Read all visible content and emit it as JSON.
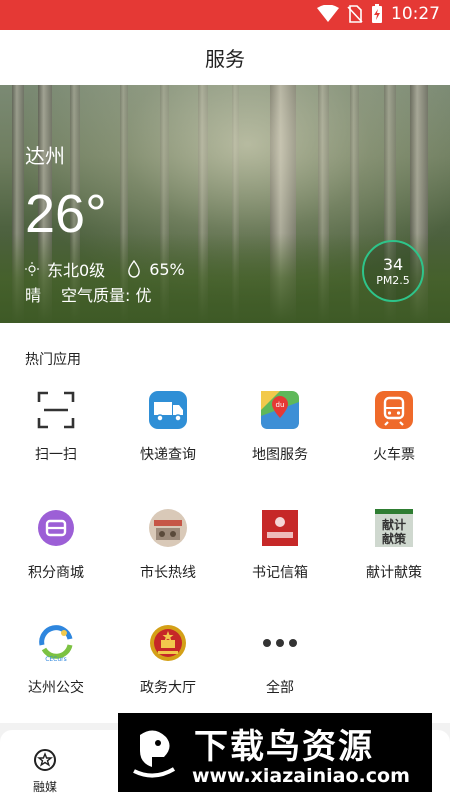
{
  "status_bar": {
    "time": "10:27",
    "icons": [
      "wifi-icon",
      "no-sim-icon",
      "battery-charging-icon"
    ]
  },
  "header": {
    "title": "服务"
  },
  "weather": {
    "city": "达州",
    "temperature": "26°",
    "wind": "东北0级",
    "humidity": "65%",
    "condition": "晴",
    "air_quality": "空气质量: 优",
    "pm_value": "34",
    "pm_label": "PM2.5"
  },
  "hot_apps": {
    "title": "热门应用",
    "items": [
      {
        "label": "扫一扫",
        "icon": "scan-icon"
      },
      {
        "label": "快递查询",
        "icon": "delivery-truck-icon"
      },
      {
        "label": "地图服务",
        "icon": "map-icon"
      },
      {
        "label": "火车票",
        "icon": "train-icon"
      },
      {
        "label": "积分商城",
        "icon": "points-mall-icon"
      },
      {
        "label": "市长热线",
        "icon": "mayor-hotline-icon"
      },
      {
        "label": "书记信箱",
        "icon": "secretary-mailbox-icon"
      },
      {
        "label": "献计献策",
        "icon": "suggestion-icon",
        "icon_text": [
          "献计",
          "献策"
        ]
      },
      {
        "label": "达州公交",
        "icon": "bus-icon",
        "icon_text": "CECurs"
      },
      {
        "label": "政务大厅",
        "icon": "government-emblem-icon"
      },
      {
        "label": "全部",
        "icon": "more-dots-icon"
      }
    ]
  },
  "tabbar": {
    "items": [
      {
        "label": "融媒",
        "icon": "star-circle-icon"
      }
    ]
  },
  "watermark": {
    "title": "下载鸟资源",
    "url": "www.xiazainiao.com"
  }
}
